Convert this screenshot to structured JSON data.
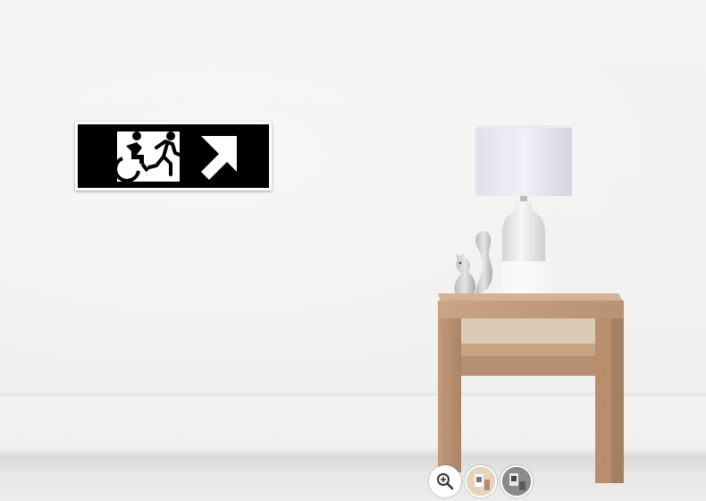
{
  "scene": {
    "wall_color": "#f3f3f1",
    "floor_color": "#e7e7e5",
    "wood_color": "#c49f7e"
  },
  "poster": {
    "background": "#000000",
    "foreground": "#ffffff",
    "icons": [
      "wheelchair-icon",
      "running-person-icon",
      "arrow-up-right-icon"
    ]
  },
  "furniture": {
    "items": [
      "table-lamp",
      "squirrel-figurine",
      "wooden-side-table"
    ]
  },
  "controls": {
    "zoom_icon": "zoom-in-icon",
    "thumbnails": [
      "thumbnail-room-view",
      "thumbnail-gray-view"
    ]
  }
}
